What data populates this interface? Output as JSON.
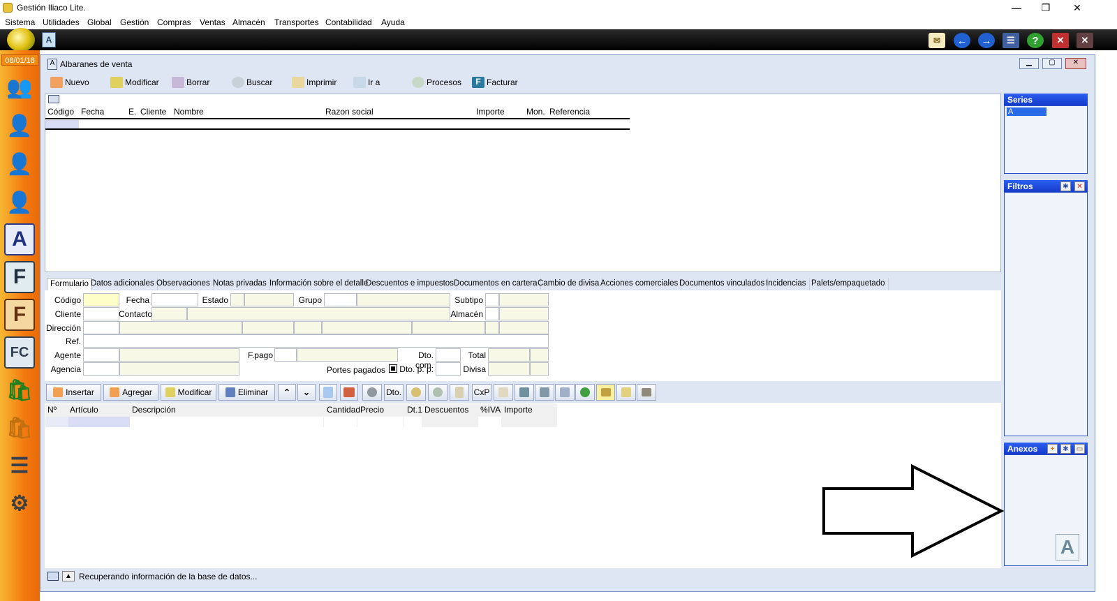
{
  "app": {
    "title": "Gestión Iliaco Lite."
  },
  "window_controls": {
    "minimize": "—",
    "maximize": "❐",
    "close": "✕"
  },
  "menu": [
    "Sistema",
    "Utilidades",
    "Global",
    "Gestión",
    "Compras",
    "Ventas",
    "Almacén",
    "Transportes",
    "Contabilidad",
    "Ayuda"
  ],
  "sidebar": {
    "date": "08/01/18"
  },
  "window": {
    "title": "Albaranes de venta"
  },
  "toolbar": [
    "Nuevo",
    "Modificar",
    "Borrar",
    "Buscar",
    "Imprimir",
    "Ir a",
    "Procesos",
    "Facturar"
  ],
  "grid": {
    "columns": [
      "Código",
      "Fecha",
      "E.",
      "Cliente",
      "Nombre",
      "Razon social",
      "Importe",
      "Mon.",
      "Referencia"
    ]
  },
  "tabs": [
    "Formulario",
    "Datos adicionales",
    "Observaciones",
    "Notas privadas",
    "Información sobre el detalle",
    "Descuentos e impuestos",
    "Documentos en cartera",
    "Cambio de divisa",
    "Acciones comerciales",
    "Documentos vinculados",
    "Incidencias",
    "Palets/empaquetado"
  ],
  "form": {
    "codigo": "Código",
    "fecha": "Fecha",
    "estado": "Estado",
    "grupo": "Grupo",
    "subtipo": "Subtipo",
    "cliente": "Cliente",
    "contacto": "Contacto",
    "almacen": "Almacén",
    "direccion": "Dirección",
    "ref": "Ref.",
    "agente": "Agente",
    "fpago": "F.pago",
    "dto_com": "Dto. com.",
    "total": "Total",
    "agencia": "Agencia",
    "portes": "Portes pagados",
    "dto_pp": "Dto. p. p.",
    "divisa": "Divisa"
  },
  "lines_toolbar": {
    "insertar": "Insertar",
    "agregar": "Agregar",
    "modificar": "Modificar",
    "eliminar": "Eliminar",
    "dto": "Dto.",
    "cxp": "CxP"
  },
  "lines": {
    "columns": [
      "Nº",
      "Artículo",
      "Descripción",
      "Cantidad",
      "Precio",
      "Dt.1",
      "Descuentos",
      "%IVA",
      "Importe"
    ]
  },
  "status": {
    "text": "Recuperando información de la base de datos..."
  },
  "panels": {
    "series": "Series",
    "series_item": "A",
    "filtros": "Filtros",
    "anexos": "Anexos"
  }
}
